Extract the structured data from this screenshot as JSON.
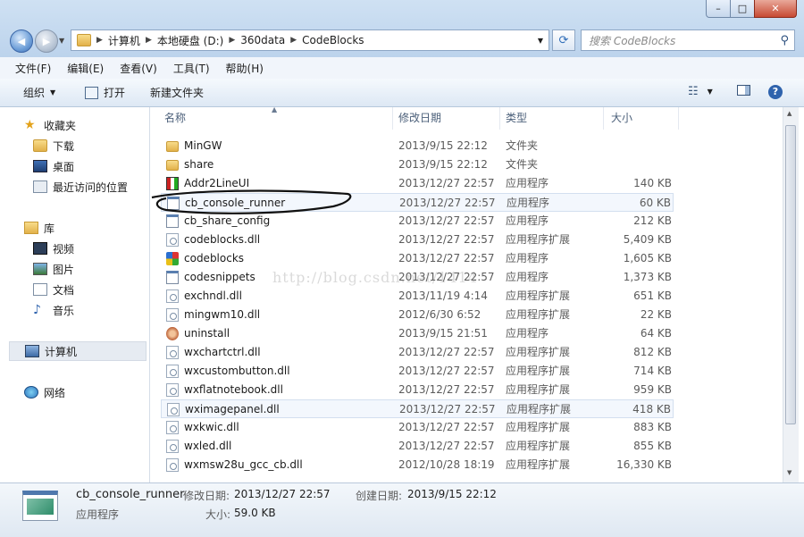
{
  "window": {
    "min_icon": "minimize-icon",
    "max_icon": "maximize-icon",
    "close_icon": "close-icon",
    "min_glyph": "–",
    "max_glyph": "□",
    "close_glyph": "✕"
  },
  "nav": {
    "back_glyph": "◀",
    "forward_glyph": "▶"
  },
  "address": {
    "crumbs": [
      "计算机",
      "本地硬盘 (D:)",
      "360data",
      "CodeBlocks"
    ]
  },
  "search": {
    "placeholder": "搜索 CodeBlocks"
  },
  "menu": [
    "文件(F)",
    "编辑(E)",
    "查看(V)",
    "工具(T)",
    "帮助(H)"
  ],
  "toolbar": {
    "organize": "组织",
    "open": "打开",
    "new_folder": "新建文件夹"
  },
  "sidebar": {
    "favorites": "收藏夹",
    "downloads": "下载",
    "desktop": "桌面",
    "recent": "最近访问的位置",
    "libraries": "库",
    "videos": "视频",
    "pictures": "图片",
    "documents": "文档",
    "music": "音乐",
    "computer": "计算机",
    "network": "网络"
  },
  "columns": {
    "name": "名称",
    "date": "修改日期",
    "type": "类型",
    "size": "大小"
  },
  "files": [
    {
      "name": "MinGW",
      "date": "2013/9/15 22:12",
      "type": "文件夹",
      "size": "",
      "icon": "folder"
    },
    {
      "name": "share",
      "date": "2013/9/15 22:12",
      "type": "文件夹",
      "size": "",
      "icon": "folder"
    },
    {
      "name": "Addr2LineUI",
      "date": "2013/12/27 22:57",
      "type": "应用程序",
      "size": "140 KB",
      "icon": "addr"
    },
    {
      "name": "cb_console_runner",
      "date": "2013/12/27 22:57",
      "type": "应用程序",
      "size": "60 KB",
      "icon": "exe"
    },
    {
      "name": "cb_share_config",
      "date": "2013/12/27 22:57",
      "type": "应用程序",
      "size": "212 KB",
      "icon": "exe"
    },
    {
      "name": "codeblocks.dll",
      "date": "2013/12/27 22:57",
      "type": "应用程序扩展",
      "size": "5,409 KB",
      "icon": "dll"
    },
    {
      "name": "codeblocks",
      "date": "2013/12/27 22:57",
      "type": "应用程序",
      "size": "1,605 KB",
      "icon": "cb"
    },
    {
      "name": "codesnippets",
      "date": "2013/12/27 22:57",
      "type": "应用程序",
      "size": "1,373 KB",
      "icon": "exe"
    },
    {
      "name": "exchndl.dll",
      "date": "2013/11/19 4:14",
      "type": "应用程序扩展",
      "size": "651 KB",
      "icon": "dll"
    },
    {
      "name": "mingwm10.dll",
      "date": "2012/6/30 6:52",
      "type": "应用程序扩展",
      "size": "22 KB",
      "icon": "dll"
    },
    {
      "name": "uninstall",
      "date": "2013/9/15 21:51",
      "type": "应用程序",
      "size": "64 KB",
      "icon": "un"
    },
    {
      "name": "wxchartctrl.dll",
      "date": "2013/12/27 22:57",
      "type": "应用程序扩展",
      "size": "812 KB",
      "icon": "dll"
    },
    {
      "name": "wxcustombutton.dll",
      "date": "2013/12/27 22:57",
      "type": "应用程序扩展",
      "size": "714 KB",
      "icon": "dll"
    },
    {
      "name": "wxflatnotebook.dll",
      "date": "2013/12/27 22:57",
      "type": "应用程序扩展",
      "size": "959 KB",
      "icon": "dll"
    },
    {
      "name": "wximagepanel.dll",
      "date": "2013/12/27 22:57",
      "type": "应用程序扩展",
      "size": "418 KB",
      "icon": "dll"
    },
    {
      "name": "wxkwic.dll",
      "date": "2013/12/27 22:57",
      "type": "应用程序扩展",
      "size": "883 KB",
      "icon": "dll"
    },
    {
      "name": "wxled.dll",
      "date": "2013/12/27 22:57",
      "type": "应用程序扩展",
      "size": "855 KB",
      "icon": "dll"
    },
    {
      "name": "wxmsw28u_gcc_cb.dll",
      "date": "2012/10/28 18:19",
      "type": "应用程序扩展",
      "size": "16,330 KB",
      "icon": "dll"
    }
  ],
  "watermark": "http://blog.csdn.net/1414",
  "details": {
    "name": "cb_console_runner",
    "type": "应用程序",
    "modified_label": "修改日期:",
    "modified": "2013/12/27 22:57",
    "created_label": "创建日期:",
    "created": "2013/9/15 22:12",
    "size_label": "大小:",
    "size": "59.0 KB"
  }
}
